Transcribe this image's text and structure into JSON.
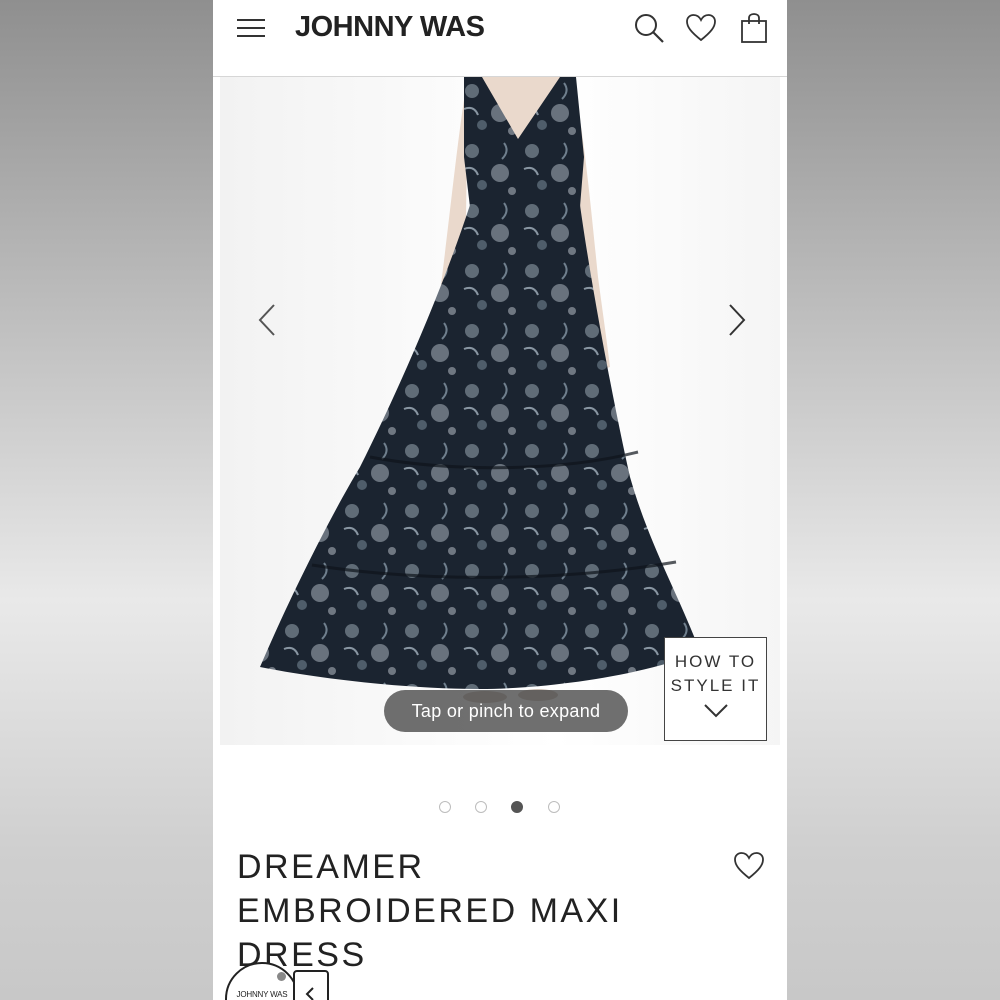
{
  "header": {
    "brand": "JOHNNY WAS",
    "menu_icon": "hamburger-menu-icon",
    "search_icon": "search-icon",
    "wishlist_icon": "heart-icon",
    "bag_icon": "shopping-bag-icon"
  },
  "gallery": {
    "prev_icon": "chevron-left-icon",
    "next_icon": "chevron-right-icon",
    "how_to_line1": "HOW TO",
    "how_to_line2": "STYLE IT",
    "expand_hint": "Tap or pinch to expand",
    "dots_total": 4,
    "active_dot": 3
  },
  "product": {
    "title_line1": "DREAMER",
    "title_line2": "EMBROIDERED MAXI",
    "title_line3": "DRESS",
    "wishlist_icon": "heart-icon"
  },
  "badge": {
    "logo_text": "JOHNNY WAS"
  },
  "colors": {
    "text": "#222222",
    "dress": "#1b2430",
    "pill": "#464646"
  }
}
